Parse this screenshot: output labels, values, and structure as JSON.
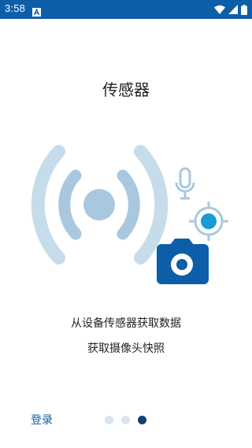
{
  "status_bar": {
    "time": "3:58",
    "background_color": "#0d5ea8",
    "icons": [
      "app-notification-icon",
      "wifi-icon",
      "signal-icon",
      "battery-icon"
    ]
  },
  "page": {
    "title": "传感器",
    "description_line1": "从设备传感器获取数据",
    "description_line2": "获取摄像头快照"
  },
  "hero": {
    "icons": [
      "wireless-signal-icon",
      "microphone-icon",
      "location-target-icon",
      "camera-icon"
    ],
    "colors": {
      "ring_light": "#c6dcea",
      "ring_mid": "#a9c8df",
      "center": "#a9c8df",
      "accent": "#0d5ea8",
      "target_fill": "#1a9ad6"
    }
  },
  "footer": {
    "login_label": "登录",
    "pagination": {
      "total": 3,
      "current": 3
    }
  }
}
